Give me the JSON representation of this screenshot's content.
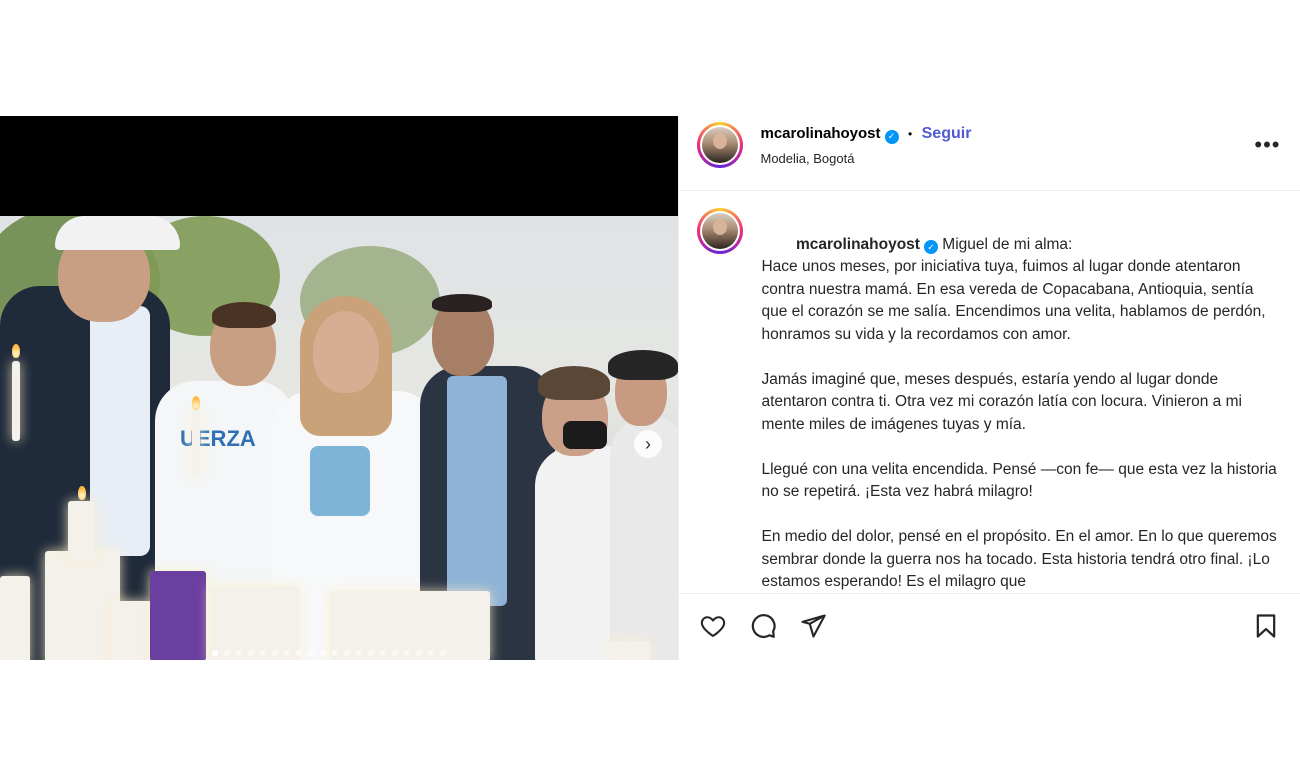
{
  "post": {
    "username": "mcarolinahoyost",
    "follow_label": "Seguir",
    "separator": "•",
    "location": "Modelia, Bogotá",
    "more_label": "•••",
    "caption_lines": [
      "Miguel de mi alma:",
      "Hace unos meses, por iniciativa tuya, fuimos al lugar donde atentaron contra nuestra mamá. En esa vereda de Copacabana, Antioquia, sentía que el corazón se me salía. Encendimos una velita, hablamos de perdón, honramos su vida y la recordamos con amor.",
      "",
      "Jamás imaginé que, meses después, estaría yendo al lugar donde atentaron contra ti. Otra vez mi corazón latía con locura. Vinieron a mi mente miles de imágenes tuyas y mía.",
      "",
      "Llegué con una velita encendida. Pensé —con fe— que esta vez la historia no se repetirá. ¡Esta vez habrá milagro!",
      "",
      "En medio del dolor, pensé en el propósito. En el amor. En lo que queremos sembrar donde la guerra nos ha tocado. Esta historia tendrá otro final. ¡Lo estamos esperando! Es el milagro que"
    ],
    "carousel": {
      "total": 20,
      "active_index": 0
    },
    "icons": {
      "next": "chevron-right-icon",
      "like": "heart-icon",
      "comment": "comment-icon",
      "share": "send-icon",
      "save": "bookmark-icon",
      "verified": "verified-badge-icon"
    },
    "colors": {
      "follow": "#4f5bd5",
      "verified": "#0095f6"
    }
  }
}
